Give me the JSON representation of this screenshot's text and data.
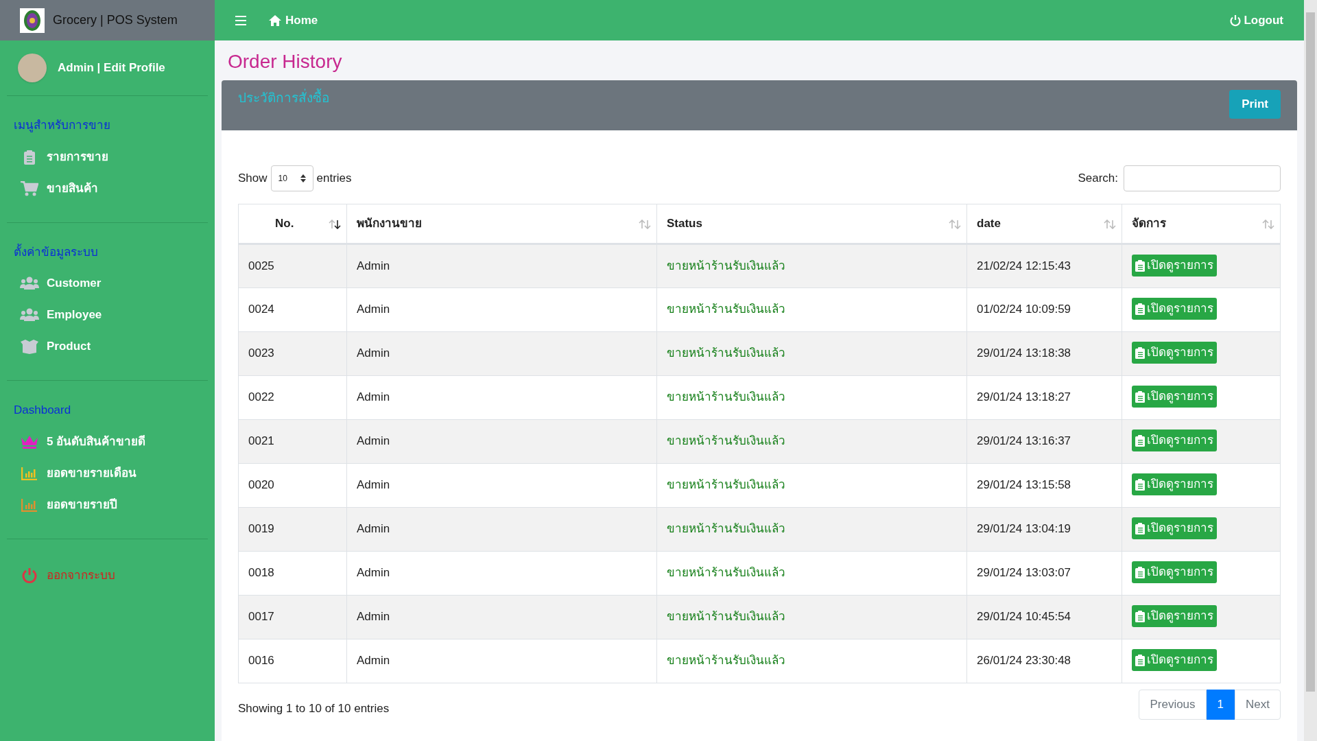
{
  "brand": {
    "title": "Grocery | POS System"
  },
  "topbar": {
    "home": "Home",
    "logout": "Logout"
  },
  "profile": {
    "label": "Admin | Edit Profile"
  },
  "sidebar": [
    {
      "heading": "เมนูสำหรับการขาย",
      "items": [
        {
          "label": "รายการขาย",
          "kind": "clipboard",
          "color": "#c8ccd4"
        },
        {
          "label": "ขายสินค้า",
          "kind": "cart",
          "color": "#c8ccd4"
        }
      ]
    },
    {
      "heading": "ตั้งค่าข้อมูลระบบ",
      "items": [
        {
          "label": "Customer",
          "kind": "users",
          "color": "#c8ccd4"
        },
        {
          "label": "Employee",
          "kind": "users",
          "color": "#c8ccd4"
        },
        {
          "label": "Product",
          "kind": "box",
          "color": "#c8ccd4"
        }
      ]
    },
    {
      "heading": "Dashboard",
      "items": [
        {
          "label": "5 อันดับสินค้าขายดี",
          "kind": "crown",
          "color": "#e020c0"
        },
        {
          "label": "ยอดขายรายเดือน",
          "kind": "chart",
          "color": "#f0c020"
        },
        {
          "label": "ยอดขายรายปี",
          "kind": "chart",
          "color": "#e09030"
        }
      ]
    },
    {
      "items": [
        {
          "label": "ออกจากระบบ",
          "kind": "power",
          "color": "#dc3545"
        }
      ]
    }
  ],
  "page_title": "Order History",
  "card": {
    "title": "ประวัติการสั่งซื้อ",
    "print": "Print"
  },
  "length": {
    "show": "Show",
    "value": "10",
    "entries": "entries"
  },
  "search": {
    "label": "Search:"
  },
  "table": {
    "columns": [
      {
        "label": "No.",
        "sorted": true
      },
      {
        "label": "พนักงานขาย",
        "sorted": false
      },
      {
        "label": "Status",
        "sorted": false
      },
      {
        "label": "date",
        "sorted": false
      },
      {
        "label": "จัดการ",
        "sorted": false
      }
    ],
    "rows": [
      {
        "no": "0025",
        "employee": "Admin",
        "status": "ขายหน้าร้านรับเงินแล้ว",
        "date": "21/02/24 12:15:43",
        "action": "เปิดดูรายการ"
      },
      {
        "no": "0024",
        "employee": "Admin",
        "status": "ขายหน้าร้านรับเงินแล้ว",
        "date": "01/02/24 10:09:59",
        "action": "เปิดดูรายการ"
      },
      {
        "no": "0023",
        "employee": "Admin",
        "status": "ขายหน้าร้านรับเงินแล้ว",
        "date": "29/01/24 13:18:38",
        "action": "เปิดดูรายการ"
      },
      {
        "no": "0022",
        "employee": "Admin",
        "status": "ขายหน้าร้านรับเงินแล้ว",
        "date": "29/01/24 13:18:27",
        "action": "เปิดดูรายการ"
      },
      {
        "no": "0021",
        "employee": "Admin",
        "status": "ขายหน้าร้านรับเงินแล้ว",
        "date": "29/01/24 13:16:37",
        "action": "เปิดดูรายการ"
      },
      {
        "no": "0020",
        "employee": "Admin",
        "status": "ขายหน้าร้านรับเงินแล้ว",
        "date": "29/01/24 13:15:58",
        "action": "เปิดดูรายการ"
      },
      {
        "no": "0019",
        "employee": "Admin",
        "status": "ขายหน้าร้านรับเงินแล้ว",
        "date": "29/01/24 13:04:19",
        "action": "เปิดดูรายการ"
      },
      {
        "no": "0018",
        "employee": "Admin",
        "status": "ขายหน้าร้านรับเงินแล้ว",
        "date": "29/01/24 13:03:07",
        "action": "เปิดดูรายการ"
      },
      {
        "no": "0017",
        "employee": "Admin",
        "status": "ขายหน้าร้านรับเงินแล้ว",
        "date": "29/01/24 10:45:54",
        "action": "เปิดดูรายการ"
      },
      {
        "no": "0016",
        "employee": "Admin",
        "status": "ขายหน้าร้านรับเงินแล้ว",
        "date": "26/01/24 23:30:48",
        "action": "เปิดดูรายการ"
      }
    ]
  },
  "info": "Showing 1 to 10 of 10 entries",
  "pagination": [
    {
      "label": "Previous",
      "selected": false
    },
    {
      "label": "1",
      "selected": true
    },
    {
      "label": "Next",
      "selected": false
    }
  ]
}
